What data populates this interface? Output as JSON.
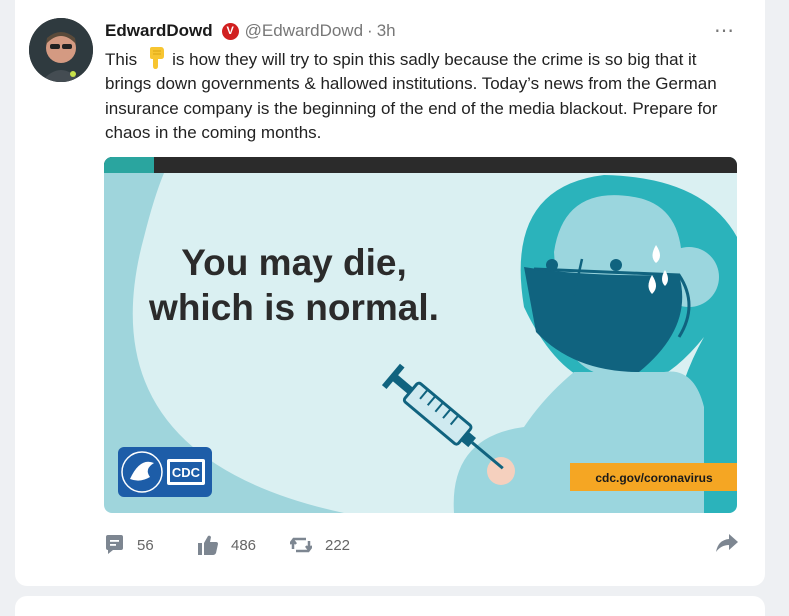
{
  "post": {
    "author_name": "EdwardDowd",
    "verified_badge": "V",
    "handle": "@EdwardDowd",
    "separator": "·",
    "time": "3h",
    "text_before_emoji": "This",
    "emoji": "backhand-index-pointing-down",
    "text_after_emoji": "is how they will try to spin this sadly because the crime is so big that it brings down governments & hallowed institutions. Today’s news from the German insurance company is the beginning of the end of the media blackout. Prepare for chaos in the coming months.",
    "more_icon": "⋯"
  },
  "media": {
    "headline_line1": "You may die,",
    "headline_line2": "which is normal.",
    "logo_text": "CDC",
    "url_tag": "cdc.gov/coronavirus"
  },
  "actions": {
    "comments": "56",
    "likes": "486",
    "reposts": "222",
    "comment_icon": "comment-icon",
    "like_icon": "thumbs-up-icon",
    "repost_icon": "repost-icon",
    "share_icon": "share-arrow-icon"
  },
  "colors": {
    "accent_red": "#d11f1f",
    "teal_light": "#9fd5dc",
    "teal_dark": "#2bb3bb",
    "cdc_blue": "#1d5da8",
    "url_tag_orange": "#f5a623",
    "mask_blue": "#10637f"
  }
}
